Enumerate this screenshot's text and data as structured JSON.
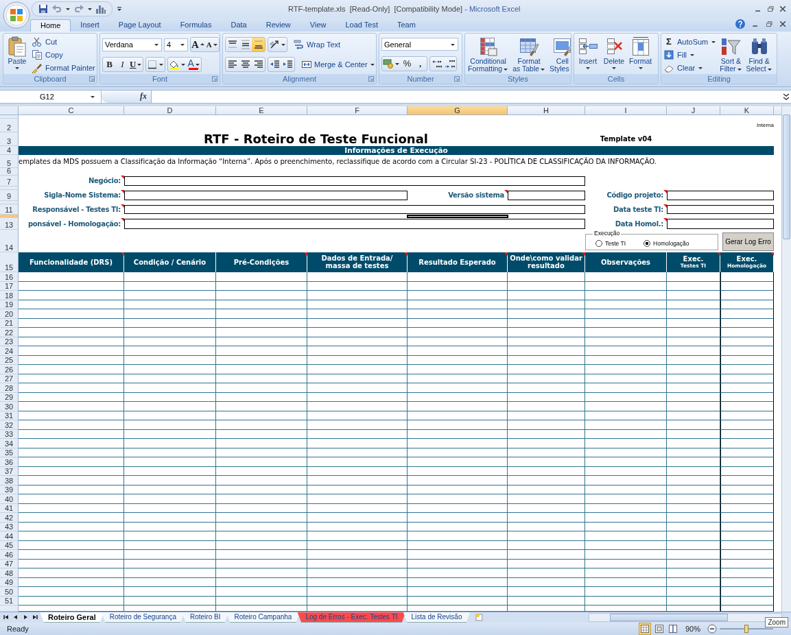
{
  "window": {
    "document": "RTF-template.xls  [Read-Only]  [Compatibility Mode]",
    "app": "- Microsoft Excel"
  },
  "ribbon_tabs": [
    {
      "label": "Home",
      "selected": true
    },
    {
      "label": "Insert",
      "selected": false
    },
    {
      "label": "Page Layout",
      "selected": false
    },
    {
      "label": "Formulas",
      "selected": false
    },
    {
      "label": "Data",
      "selected": false
    },
    {
      "label": "Review",
      "selected": false
    },
    {
      "label": "View",
      "selected": false
    },
    {
      "label": "Load Test",
      "selected": false
    },
    {
      "label": "Team",
      "selected": false
    }
  ],
  "ribbon_groups": [
    {
      "label": "Clipboard",
      "blocks": [
        {
          "kind": "paste",
          "lines": [
            "Paste"
          ]
        },
        {
          "kind": "stack",
          "items": [
            {
              "kind": "cut",
              "label": "Cut"
            },
            {
              "kind": "copy",
              "label": "Copy"
            },
            {
              "kind": "painter",
              "label": "Format Painter"
            }
          ]
        }
      ]
    },
    {
      "label": "Font",
      "blocks": [
        {
          "kind": "rows",
          "rows": [
            [
              {
                "kind": "field",
                "value": "Verdana"
              },
              {
                "kind": "field",
                "value": "4"
              },
              {
                "kind": "group",
                "buttons": [
                  {
                    "kind": "grow",
                    "label": "A"
                  },
                  {
                    "kind": "shrink",
                    "label": "A"
                  }
                ]
              }
            ],
            [
              {
                "kind": "group",
                "buttons": [
                  {
                    "kind": "bold",
                    "label": "B"
                  },
                  {
                    "kind": "italic",
                    "label": "I"
                  },
                  {
                    "kind": "underline",
                    "label": "U"
                  }
                ]
              },
              {
                "kind": "group",
                "buttons": [
                  {
                    "kind": "borders"
                  }
                ]
              },
              {
                "kind": "group",
                "buttons": [
                  {
                    "kind": "fill",
                    "color": "#ffff00"
                  },
                  {
                    "kind": "fontcolor",
                    "label": "A",
                    "color": "#ff0000"
                  }
                ]
              }
            ]
          ]
        }
      ]
    },
    {
      "label": "Alignment",
      "blocks": [
        {
          "kind": "rows",
          "rows": [
            [
              {
                "kind": "group",
                "buttons": [
                  {
                    "kind": "top",
                    "selected": false
                  },
                  {
                    "kind": "middle",
                    "selected": false
                  },
                  {
                    "kind": "bottom",
                    "selected": true
                  }
                ]
              },
              {
                "kind": "group",
                "buttons": [
                  {
                    "kind": "orientation"
                  }
                ]
              },
              {
                "kind": "wrap",
                "label": "Wrap Text"
              }
            ],
            [
              {
                "kind": "group",
                "buttons": [
                  {
                    "kind": "left"
                  },
                  {
                    "kind": "center"
                  },
                  {
                    "kind": "right"
                  }
                ]
              },
              {
                "kind": "group",
                "buttons": [
                  {
                    "kind": "outdent"
                  },
                  {
                    "kind": "indent"
                  }
                ]
              },
              {
                "kind": "merge",
                "label": "Merge & Center"
              }
            ]
          ]
        }
      ]
    },
    {
      "label": "Number",
      "blocks": [
        {
          "kind": "rows",
          "rows": [
            [
              {
                "kind": "field",
                "value": "General"
              }
            ],
            [
              {
                "kind": "group",
                "buttons": [
                  {
                    "kind": "currency"
                  },
                  {
                    "kind": "percent",
                    "label": "%"
                  },
                  {
                    "kind": "comma",
                    "label": ","
                  }
                ]
              },
              {
                "kind": "group",
                "buttons": [
                  {
                    "kind": "moredecimals"
                  },
                  {
                    "kind": "fewerdecimals"
                  }
                ]
              }
            ]
          ]
        }
      ]
    },
    {
      "label": "Styles",
      "blocks": [
        {
          "kind": "conditional",
          "lines": [
            "Conditional",
            "Formatting"
          ]
        },
        {
          "kind": "table",
          "lines": [
            "Format",
            "as Table"
          ]
        },
        {
          "kind": "styles",
          "lines": [
            "Cell",
            "Styles"
          ]
        }
      ]
    },
    {
      "label": "Cells",
      "blocks": [
        {
          "kind": "insert",
          "lines": [
            "Insert"
          ]
        },
        {
          "kind": "delete",
          "lines": [
            "Delete"
          ]
        },
        {
          "kind": "format",
          "lines": [
            "Format"
          ]
        }
      ]
    },
    {
      "label": "Editing",
      "blocks": [
        {
          "kind": "stack",
          "items": [
            {
              "kind": "autosum",
              "glyph": "Σ",
              "label": "AutoSum"
            },
            {
              "kind": "fill",
              "label": "Fill"
            },
            {
              "kind": "clear",
              "label": "Clear"
            }
          ]
        },
        {
          "kind": "sort",
          "lines": [
            "Sort &",
            "Filter"
          ]
        },
        {
          "kind": "find",
          "lines": [
            "Find &",
            "Select"
          ]
        }
      ]
    }
  ],
  "formula_bar": {
    "name_box": "G12",
    "fx": "fx"
  },
  "columns": [
    {
      "label": "C",
      "selected": false
    },
    {
      "label": "D",
      "selected": false
    },
    {
      "label": "E",
      "selected": false
    },
    {
      "label": "F",
      "selected": false
    },
    {
      "label": "G",
      "selected": true
    },
    {
      "label": "H",
      "selected": false
    },
    {
      "label": "I",
      "selected": false
    },
    {
      "label": "J",
      "selected": false
    },
    {
      "label": "K",
      "selected": false
    }
  ],
  "rows": [
    {
      "selected": false
    },
    {
      "label": "2",
      "selected": false
    },
    {
      "label": "3",
      "selected": false
    },
    {
      "label": "4",
      "selected": false
    },
    {
      "label": "5",
      "selected": false
    },
    {
      "label": "6",
      "selected": false
    },
    {
      "label": "7",
      "selected": false
    },
    {
      "selected": false
    },
    {
      "label": "9",
      "selected": false
    },
    {
      "selected": false
    },
    {
      "label": "11",
      "selected": false
    },
    {
      "selected": true
    },
    {
      "label": "13",
      "selected": false
    },
    {
      "label": "14",
      "selected": false
    },
    {
      "label": "15",
      "selected": false
    },
    {
      "label": "16",
      "selected": false
    },
    {
      "label": "17",
      "selected": false
    },
    {
      "label": "18",
      "selected": false
    },
    {
      "label": "19",
      "selected": false
    },
    {
      "label": "20",
      "selected": false
    },
    {
      "label": "21",
      "selected": false
    },
    {
      "label": "22",
      "selected": false
    },
    {
      "label": "23",
      "selected": false
    },
    {
      "label": "24",
      "selected": false
    },
    {
      "label": "25",
      "selected": false
    },
    {
      "label": "26",
      "selected": false
    },
    {
      "label": "27",
      "selected": false
    },
    {
      "label": "28",
      "selected": false
    },
    {
      "label": "29",
      "selected": false
    },
    {
      "label": "30",
      "selected": false
    },
    {
      "label": "31",
      "selected": false
    },
    {
      "label": "32",
      "selected": false
    },
    {
      "label": "33",
      "selected": false
    },
    {
      "label": "34",
      "selected": false
    },
    {
      "label": "35",
      "selected": false
    },
    {
      "label": "36",
      "selected": false
    },
    {
      "label": "37",
      "selected": false
    },
    {
      "label": "38",
      "selected": false
    },
    {
      "label": "39",
      "selected": false
    },
    {
      "label": "40",
      "selected": false
    },
    {
      "label": "41",
      "selected": false
    },
    {
      "label": "42",
      "selected": false
    },
    {
      "label": "43",
      "selected": false
    },
    {
      "label": "44",
      "selected": false
    },
    {
      "label": "45",
      "selected": false
    },
    {
      "label": "46",
      "selected": false
    },
    {
      "label": "47",
      "selected": false
    },
    {
      "label": "48",
      "selected": false
    },
    {
      "label": "49",
      "selected": false
    },
    {
      "label": "50",
      "selected": false
    },
    {
      "label": "51",
      "selected": false
    },
    {
      "selected": false
    }
  ],
  "sheet": {
    "classification": "Interna",
    "title": "RTF - Roteiro de Teste Funcional",
    "version": "Template v04",
    "section": "Informações de Execução",
    "notice": "emplates da MDS possuem a Classificação da Informação “Interna”. Após o preenchimento, reclassifique de acordo com a Circular SI-23 - POLÍTICA DE CLASSIFICAÇÃO DA INFORMAÇÃO.",
    "fields": [
      {
        "label": "Negócio:",
        "comment": true
      },
      {
        "label": "Sigla-Nome Sistema:",
        "comment": true
      },
      {
        "label": "Versão sistema",
        "comment": true
      },
      {
        "label": "Código projeto:",
        "comment": true
      },
      {
        "label": "Responsável - Testes TI:",
        "comment": true
      },
      {
        "label": "Data teste TI:",
        "comment": true
      },
      {
        "label": "ponsável - Homologação:",
        "comment": true
      },
      {
        "label": "Data Homol.:",
        "comment": true
      }
    ],
    "execution": {
      "title": "Execução",
      "options": [
        {
          "label": "Teste TI",
          "selected": false
        },
        {
          "label": "Homologação",
          "selected": true
        }
      ]
    },
    "log_button": "Gerar Log Erro",
    "headers": [
      {
        "label": "Funcionalidade (DRS)",
        "comment": true
      },
      {
        "label": "Condição / Cenário",
        "comment": false
      },
      {
        "label": "Pré-Condições",
        "comment": true
      },
      {
        "label": "Dados de Entrada/ massa de testes",
        "comment": true
      },
      {
        "label": "Resultado Esperado",
        "comment": true
      },
      {
        "label": "Onde\\como validar resultado",
        "comment": true
      },
      {
        "label": "Observações",
        "comment": false
      },
      {
        "label": "Exec.",
        "sublabel": "Testes TI",
        "comment": true
      },
      {
        "label": "Exec.",
        "sublabel": "Homologação",
        "comment": true
      }
    ]
  },
  "sheet_tabs": [
    {
      "label": "Roteiro Geral",
      "selected": true,
      "color": "#ffffff"
    },
    {
      "label": "Roteiro de Segurança",
      "selected": false,
      "color": "#f3f6fb"
    },
    {
      "label": "Roteiro BI",
      "selected": false,
      "color": "#f3f6fb"
    },
    {
      "label": "Roteiro Campanha",
      "selected": false,
      "color": "#f3f6fb"
    },
    {
      "label": "Log de Erros - Exec. Testes TI",
      "selected": false,
      "color": "#ff4a4a"
    },
    {
      "label": "Lista de Revisão",
      "selected": false,
      "color": "#f3f6fb"
    }
  ],
  "status_bar": {
    "status": "Ready",
    "views": [
      {
        "kind": "normal",
        "selected": true
      },
      {
        "kind": "layout",
        "selected": false
      },
      {
        "kind": "pagebreak",
        "selected": false
      }
    ],
    "zoom": "90%",
    "zoom_level": {
      "level": 0.5
    },
    "tooltip": "Zoom"
  }
}
